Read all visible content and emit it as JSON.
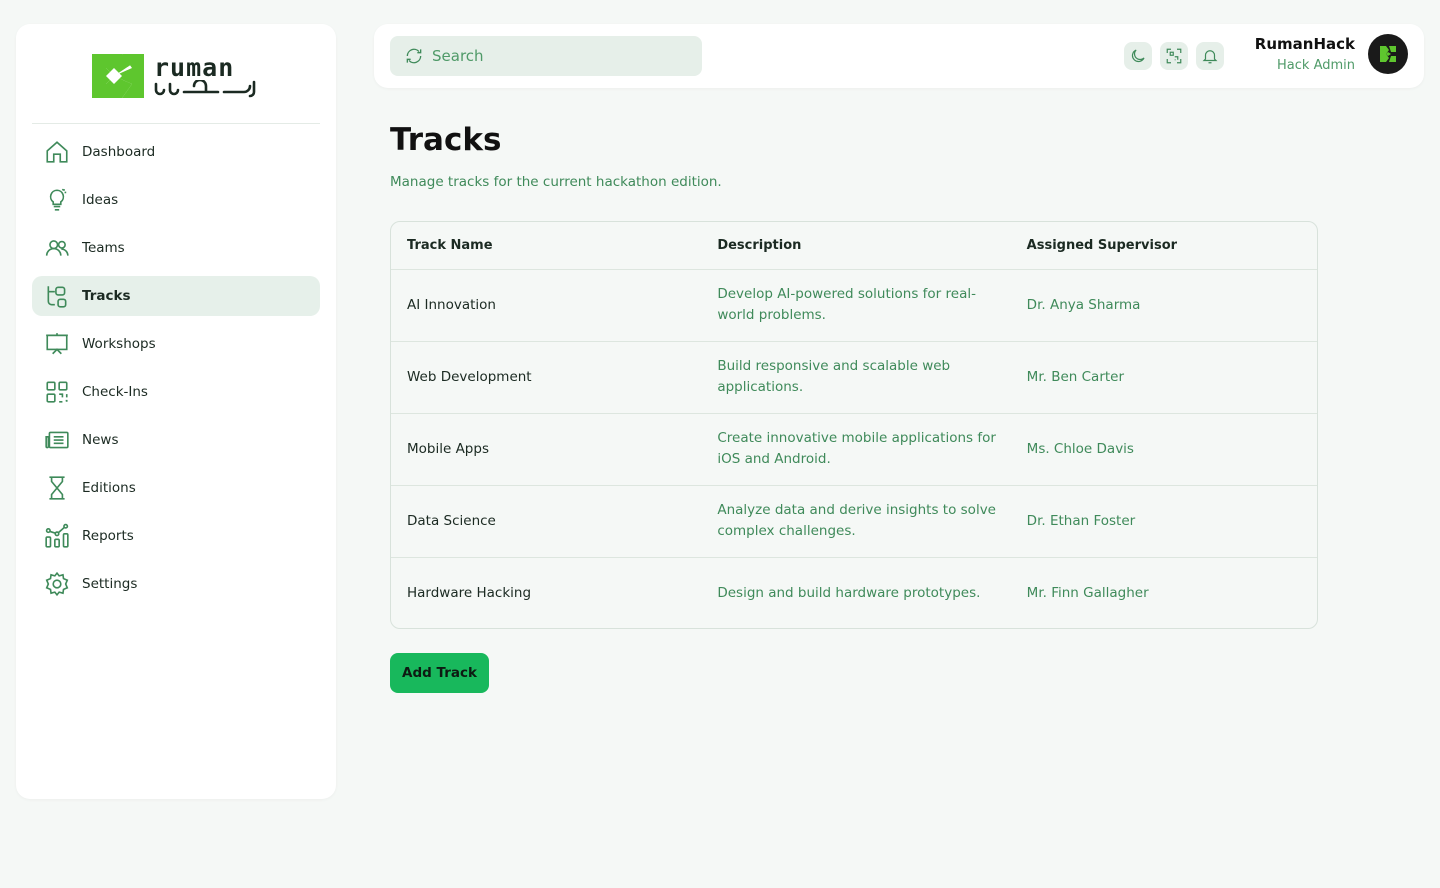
{
  "brand": {
    "latin_name": "ruman",
    "accent": "#18b85c",
    "logo_green": "#5ec62e"
  },
  "sidebar": {
    "items": [
      {
        "label": "Dashboard",
        "icon": "home-icon"
      },
      {
        "label": "Ideas",
        "icon": "lightbulb-icon"
      },
      {
        "label": "Teams",
        "icon": "users-icon"
      },
      {
        "label": "Tracks",
        "icon": "tracks-icon",
        "active": true
      },
      {
        "label": "Workshops",
        "icon": "presentation-icon"
      },
      {
        "label": "Check-Ins",
        "icon": "qr-code-icon"
      },
      {
        "label": "News",
        "icon": "newspaper-icon"
      },
      {
        "label": "Editions",
        "icon": "hourglass-icon"
      },
      {
        "label": "Reports",
        "icon": "bar-chart-icon"
      },
      {
        "label": "Settings",
        "icon": "gear-icon"
      }
    ]
  },
  "topbar": {
    "search_placeholder": "Search",
    "icons": [
      "moon-icon",
      "scan-icon",
      "bell-icon"
    ],
    "user_name": "RumanHack",
    "user_role": "Hack Admin"
  },
  "page": {
    "title": "Tracks",
    "subtitle": "Manage tracks for the current hackathon edition."
  },
  "table": {
    "headers": [
      "Track Name",
      "Description",
      "Assigned Supervisor"
    ],
    "rows": [
      {
        "name": "AI Innovation",
        "description": "Develop AI-powered solutions for real-world problems.",
        "supervisor": "Dr. Anya Sharma"
      },
      {
        "name": "Web Development",
        "description": "Build responsive and scalable web applications.",
        "supervisor": "Mr. Ben Carter"
      },
      {
        "name": "Mobile Apps",
        "description": "Create innovative mobile applications for iOS and Android.",
        "supervisor": "Ms. Chloe Davis"
      },
      {
        "name": "Data Science",
        "description": "Analyze data and derive insights to solve complex challenges.",
        "supervisor": "Dr. Ethan Foster"
      },
      {
        "name": "Hardware Hacking",
        "description": "Design and build hardware prototypes.",
        "supervisor": "Mr. Finn Gallagher"
      }
    ]
  },
  "actions": {
    "add_label": "Add Track"
  }
}
